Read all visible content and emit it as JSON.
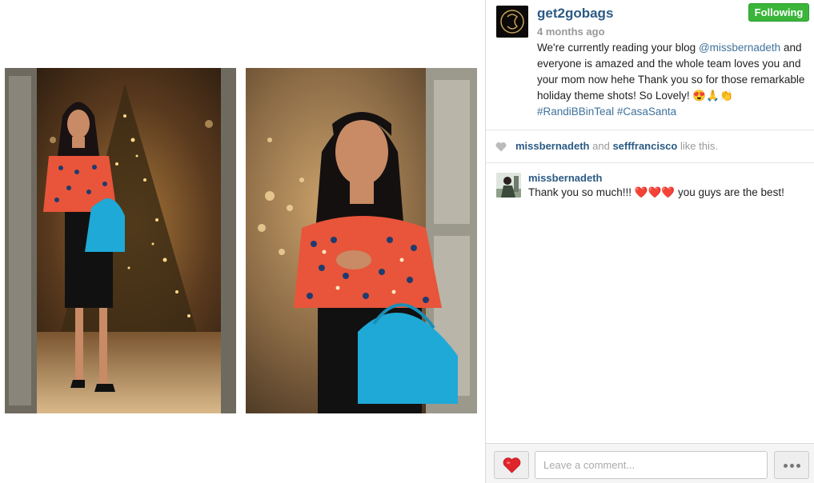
{
  "post": {
    "username": "get2gobags",
    "timestamp": "4 months ago",
    "follow_label": "Following",
    "caption": {
      "part1": "We're currently reading your blog ",
      "mention": "@missbernadeth",
      "part2": " and everyone is amazed and the whole team loves you and your mom now hehe Thank you so for those remarkable holiday theme shots! So Lovely! ",
      "emoji": "😍🙏👏",
      "hashtag1": "#RandiBBinTeal",
      "hashtag2": "#CasaSanta"
    }
  },
  "likes": {
    "user1": "missbernadeth",
    "and": "and",
    "user2": "sefffrancisco",
    "suffix": "like this."
  },
  "comments": [
    {
      "user": "missbernadeth",
      "text": "Thank you so much!!! ❤️❤️❤️ you guys are the best!"
    }
  ],
  "footer": {
    "comment_placeholder": "Leave a comment..."
  },
  "colors": {
    "follow_green": "#3ab53a",
    "link_blue": "#2b5a83",
    "heart_red": "#e0242b",
    "bag_teal": "#1fa9d6"
  }
}
